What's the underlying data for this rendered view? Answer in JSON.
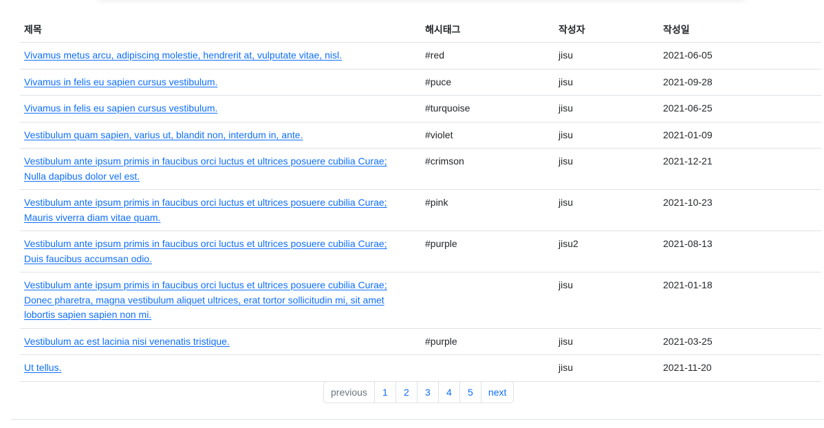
{
  "table": {
    "headers": {
      "title": "제목",
      "hashtag": "해시태그",
      "author": "작성자",
      "date": "작성일"
    },
    "rows": [
      {
        "title": [
          "Vivamus metus arcu, adipiscing molestie, hendrerit at, vulputate vitae, nisl."
        ],
        "hashtag": "#red",
        "author": "jisu",
        "date": "2021-06-05"
      },
      {
        "title": [
          "Vivamus in felis eu sapien cursus vestibulum."
        ],
        "hashtag": "#puce",
        "author": "jisu",
        "date": "2021-09-28"
      },
      {
        "title": [
          "Vivamus in felis eu sapien cursus vestibulum."
        ],
        "hashtag": "#turquoise",
        "author": "jisu",
        "date": "2021-06-25"
      },
      {
        "title": [
          "Vestibulum quam sapien, varius ut, blandit non, interdum in, ante."
        ],
        "hashtag": "#violet",
        "author": "jisu",
        "date": "2021-01-09"
      },
      {
        "title": [
          "Vestibulum ante ipsum primis in faucibus orci luctus et ultrices posuere cubilia Curae;",
          "Nulla dapibus dolor vel est."
        ],
        "hashtag": "#crimson",
        "author": "jisu",
        "date": "2021-12-21"
      },
      {
        "title": [
          "Vestibulum ante ipsum primis in faucibus orci luctus et ultrices posuere cubilia Curae;",
          "Mauris viverra diam vitae quam."
        ],
        "hashtag": "#pink",
        "author": "jisu",
        "date": "2021-10-23"
      },
      {
        "title": [
          "Vestibulum ante ipsum primis in faucibus orci luctus et ultrices posuere cubilia Curae;",
          "Duis faucibus accumsan odio."
        ],
        "hashtag": "#purple",
        "author": "jisu2",
        "date": "2021-08-13"
      },
      {
        "title": [
          "Vestibulum ante ipsum primis in faucibus orci luctus et ultrices posuere cubilia Curae;",
          "Donec pharetra, magna vestibulum aliquet ultrices, erat tortor sollicitudin mi, sit amet",
          "lobortis sapien sapien non mi."
        ],
        "hashtag": "",
        "author": "jisu",
        "date": "2021-01-18"
      },
      {
        "title": [
          "Vestibulum ac est lacinia nisi venenatis tristique."
        ],
        "hashtag": "#purple",
        "author": "jisu",
        "date": "2021-03-25"
      },
      {
        "title": [
          "Ut tellus."
        ],
        "hashtag": "",
        "author": "jisu",
        "date": "2021-11-20"
      }
    ]
  },
  "pagination": {
    "previous": "previous",
    "pages": [
      "1",
      "2",
      "3",
      "4",
      "5"
    ],
    "next": "next"
  },
  "colors": {
    "link": "#0d6efd",
    "disabled": "#6c757d",
    "border": "#dee2e6"
  }
}
